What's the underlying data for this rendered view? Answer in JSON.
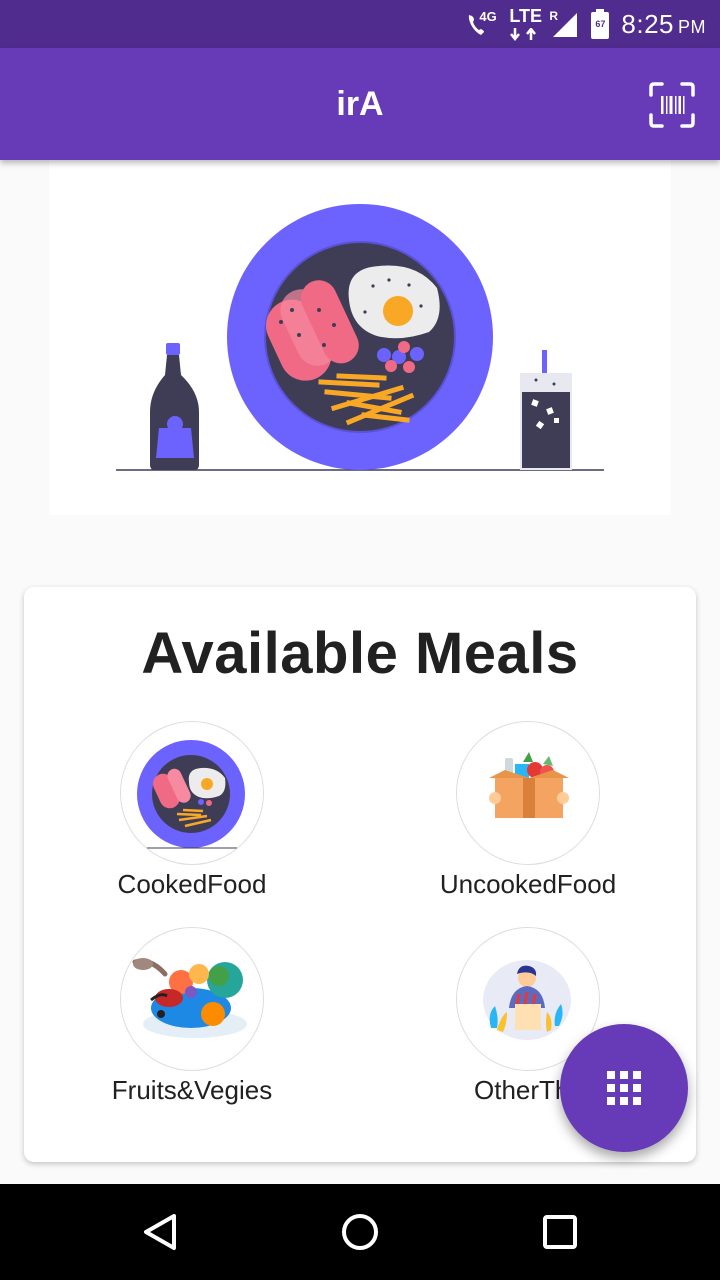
{
  "status_bar": {
    "network": "4G",
    "lte": "LTE",
    "roaming": "R",
    "battery": "67",
    "time": "8:25",
    "ampm": "PM",
    "icons": [
      "wifi-calling-icon",
      "lte-icon",
      "signal-icon",
      "battery-icon"
    ]
  },
  "app_bar": {
    "title": "irA",
    "scan_icon": "barcode-scanner-icon",
    "background": "#673ab7"
  },
  "hero": {
    "illustration": "breakfast-plate-illustration",
    "accent": "#6c63ff"
  },
  "meals": {
    "title": "Available Meals",
    "items": [
      {
        "label": "CookedFood",
        "icon": "cooked-food-icon"
      },
      {
        "label": "UncookedFood",
        "icon": "grocery-box-icon"
      },
      {
        "label": "Fruits&Vegies",
        "icon": "fruits-vegies-icon"
      },
      {
        "label": "OtherThings",
        "icon": "other-things-icon"
      }
    ]
  },
  "fab": {
    "icon": "grid-icon",
    "color": "#673ab7"
  },
  "nav": {
    "back_icon": "back-icon",
    "home_icon": "home-icon",
    "recents_icon": "recents-icon"
  }
}
